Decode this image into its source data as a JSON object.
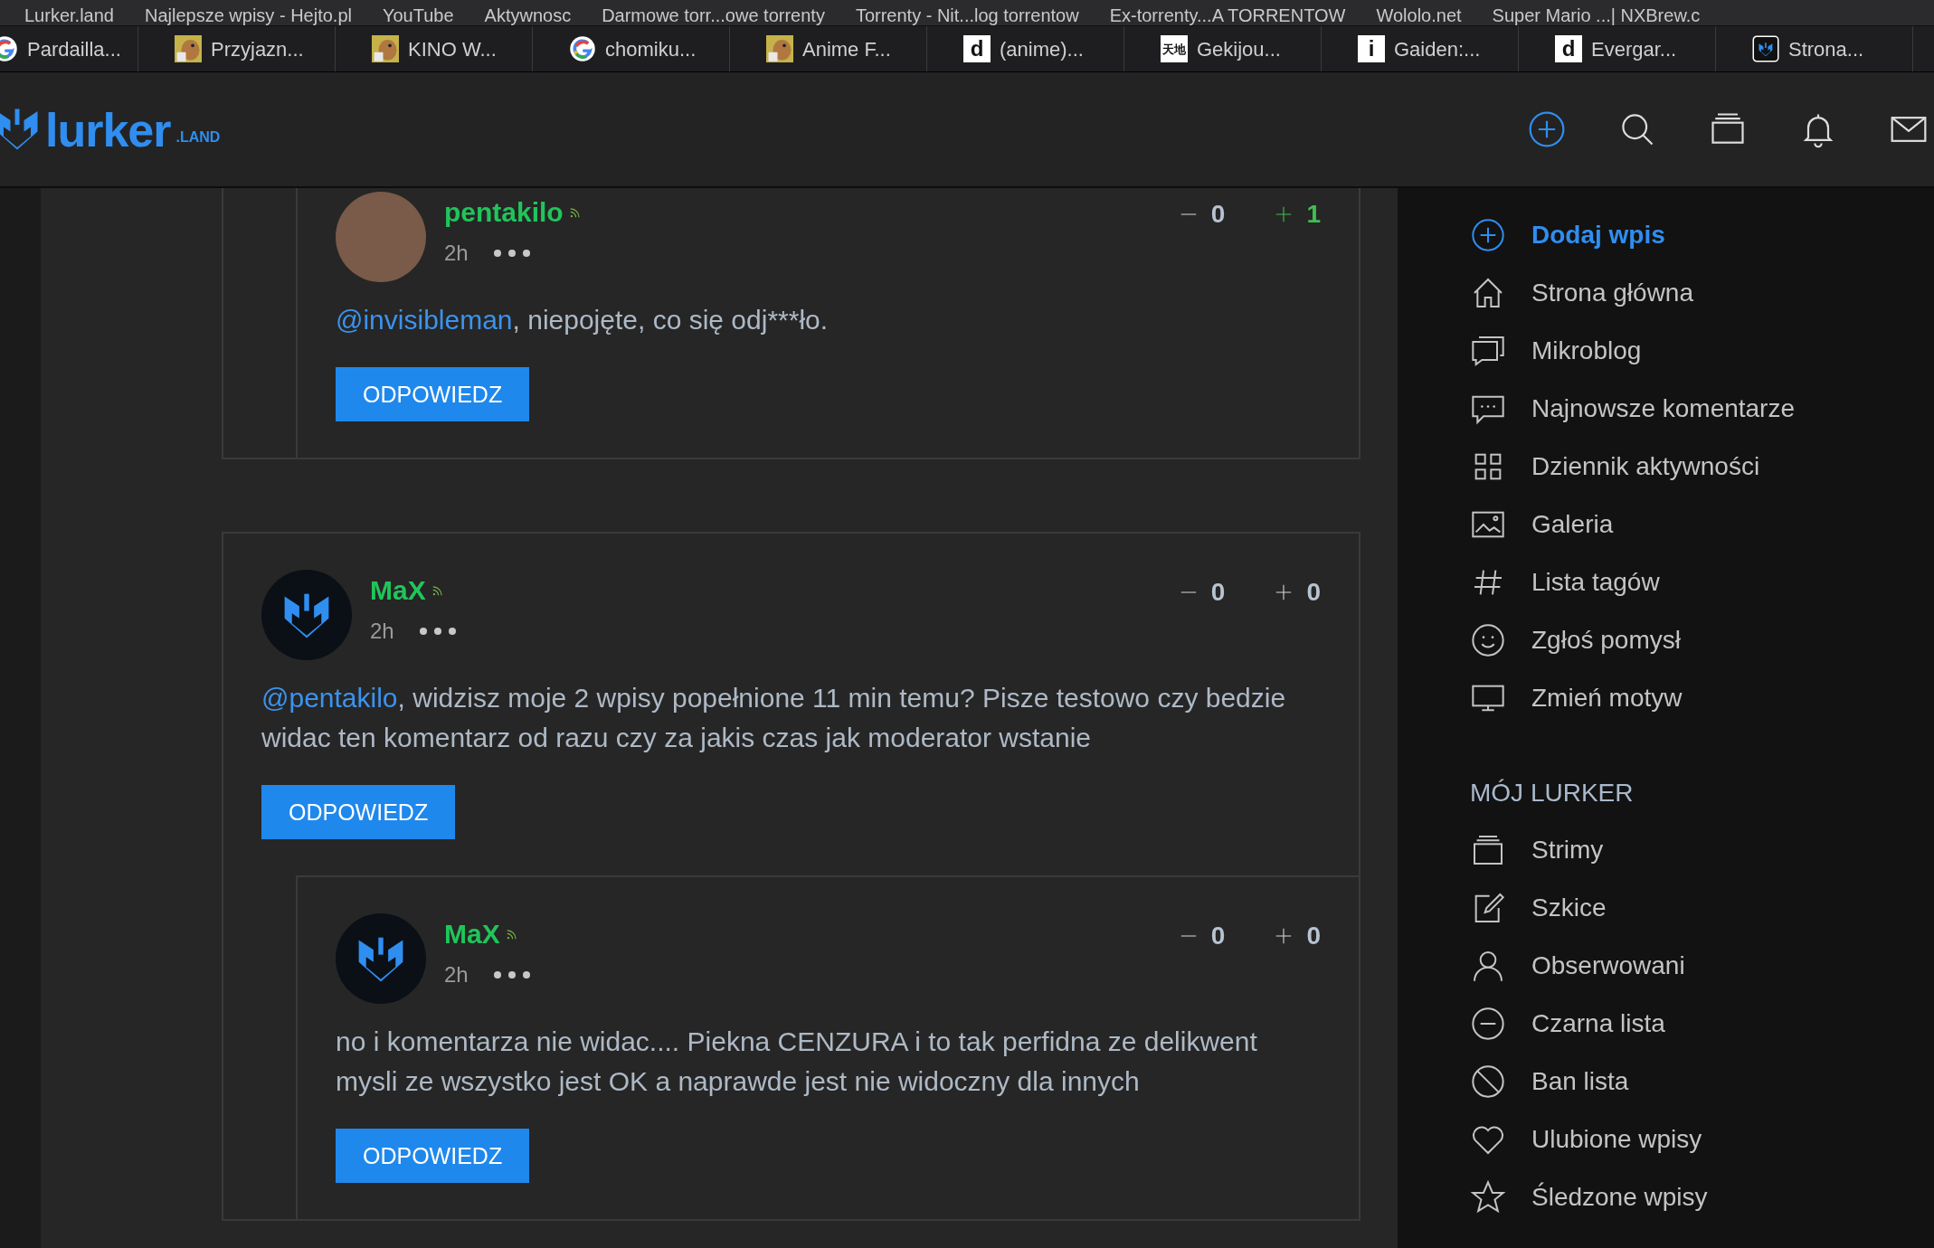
{
  "bookmarks": [
    "Lurker.land",
    "Najlepsze wpisy - Hejto.pl",
    "YouTube",
    "Aktywnosc",
    "Darmowe torr...owe torrenty",
    "Torrenty - Nit...log torrentow",
    "Ex-torrenty...A TORRENTOW",
    "Wololo.net",
    "Super Mario ...| NXBrew.c"
  ],
  "tabs": [
    {
      "title": "Pardailla...",
      "kind": "google"
    },
    {
      "title": "Przyjazn...",
      "kind": "thumb"
    },
    {
      "title": "KINO W...",
      "kind": "thumb"
    },
    {
      "title": "chomiku...",
      "kind": "google"
    },
    {
      "title": "Anime F...",
      "kind": "thumb"
    },
    {
      "title": "(anime)...",
      "kind": "glyph",
      "glyph": "d"
    },
    {
      "title": "Gekijou...",
      "kind": "glyph",
      "glyph": "天地"
    },
    {
      "title": "Gaiden:...",
      "kind": "glyph",
      "glyph": "i"
    },
    {
      "title": "Evergar...",
      "kind": "glyph",
      "glyph": "d"
    },
    {
      "title": "Strona...",
      "kind": "logo"
    }
  ],
  "header": {
    "logo": "lurker",
    "logo_suffix": ".LAND"
  },
  "threads": [
    {
      "replies": [
        {
          "author": "pentakilo",
          "kind": "photo",
          "time": "2h",
          "mention": "@invisibleman",
          "text": ", niepojęte, co się odj***ło.",
          "down": "0",
          "up": "1",
          "upvoted": true,
          "reply": "ODPOWIEDZ"
        }
      ]
    },
    {
      "comment": {
        "author": "MaX",
        "kind": "logo",
        "time": "2h",
        "mention": "@pentakilo",
        "text": ", widzisz moje 2 wpisy popełnione 11 min temu? Pisze testowo czy bedzie widac ten komentarz od razu czy za jakis czas jak moderator wstanie",
        "down": "0",
        "up": "0",
        "upvoted": false,
        "reply": "ODPOWIEDZ"
      },
      "replies": [
        {
          "author": "MaX",
          "kind": "logo",
          "time": "2h",
          "text": "no i komentarza nie widac.... Piekna CENZURA i to tak perfidna ze delikwent mysli ze wszystko jest OK a naprawde jest nie widoczny dla innych",
          "down": "0",
          "up": "0",
          "upvoted": false,
          "reply": "ODPOWIEDZ"
        }
      ]
    }
  ],
  "sidebar": {
    "items": [
      {
        "label": "Dodaj wpis",
        "kind": "action"
      },
      {
        "label": "Strona główna",
        "kind": "link"
      },
      {
        "label": "Mikroblog",
        "kind": "link"
      },
      {
        "label": "Najnowsze komentarze",
        "kind": "link"
      },
      {
        "label": "Dziennik aktywności",
        "kind": "link"
      },
      {
        "label": "Galeria",
        "kind": "link"
      },
      {
        "label": "Lista tagów",
        "kind": "link"
      },
      {
        "label": "Zgłoś pomysł",
        "kind": "link"
      },
      {
        "label": "Zmień motyw",
        "kind": "link"
      }
    ],
    "section_title": "MÓJ LURKER",
    "my_items": [
      {
        "label": "Strimy"
      },
      {
        "label": "Szkice"
      },
      {
        "label": "Obserwowani"
      },
      {
        "label": "Czarna lista"
      },
      {
        "label": "Ban lista"
      },
      {
        "label": "Ulubione wpisy"
      },
      {
        "label": "Śledzone wpisy"
      }
    ]
  }
}
